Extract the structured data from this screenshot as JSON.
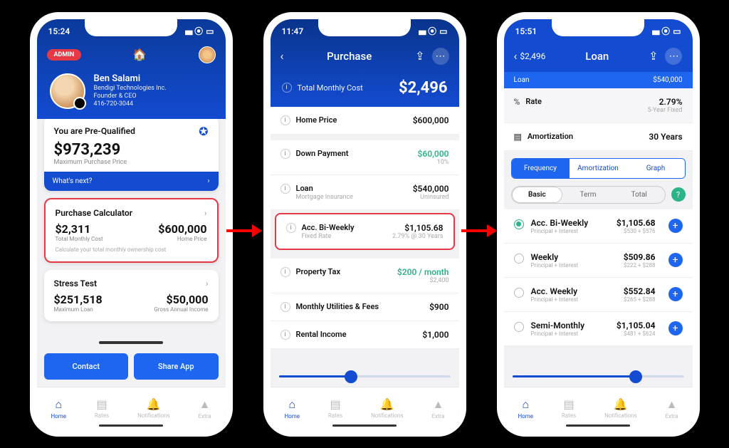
{
  "phone1": {
    "time": "15:24",
    "admin_badge": "ADMIN",
    "profile": {
      "name": "Ben Salami",
      "company": "Bendigi Technologies Inc.",
      "title": "Founder & CEO",
      "phone": "416-720-3044"
    },
    "prequalified": {
      "title": "You are Pre-Qualified",
      "amount": "$973,239",
      "sub": "Maximum Purchase Price",
      "next": "What's next?"
    },
    "calc": {
      "title": "Purchase Calculator",
      "left_val": "$2,311",
      "left_lab": "Total Monthly Cost",
      "right_val": "$600,000",
      "right_lab": "Home Price",
      "hint": "Calculate your total monthly ownership cost"
    },
    "stress": {
      "title": "Stress Test",
      "left_val": "$251,518",
      "left_lab": "Maximum Loan",
      "right_val": "$50,000",
      "right_lab": "Gross Annual Income"
    },
    "cta": {
      "contact": "Contact",
      "share": "Share App"
    }
  },
  "phone2": {
    "time": "11:47",
    "title": "Purchase",
    "total_label": "Total Monthly Cost",
    "total_value": "$2,496",
    "rows": {
      "home_price": {
        "label": "Home Price",
        "value": "$600,000"
      },
      "down": {
        "label": "Down Payment",
        "value": "$60,000",
        "sub": "10%"
      },
      "loan": {
        "label": "Loan",
        "sub_l": "Mortgage Insurance",
        "value": "$540,000",
        "sub": "Uninsured"
      },
      "biweekly": {
        "label": "Acc. Bi-Weekly",
        "sub_l": "Fixed Rate",
        "value": "$1,105.68",
        "sub": "2.79% @ 30 Years"
      },
      "tax": {
        "label": "Property Tax",
        "value": "$200 / month",
        "sub": "$2,400"
      },
      "util": {
        "label": "Monthly Utilities & Fees",
        "value": "$900"
      },
      "rent": {
        "label": "Rental Income",
        "value": "$1,000"
      }
    }
  },
  "phone3": {
    "time": "15:51",
    "back_crumb": "$2,496",
    "title": "Loan",
    "crumb_left": "Loan",
    "crumb_right": "$540,000",
    "rate": {
      "label": "Rate",
      "value": "2.79%",
      "sub": "5-Year Fixed"
    },
    "amort": {
      "label": "Amortization",
      "value": "30 Years"
    },
    "segs": {
      "a": "Frequency",
      "b": "Amortization",
      "c": "Graph"
    },
    "subsegs": {
      "a": "Basic",
      "b": "Term",
      "c": "Total"
    },
    "opts": {
      "o1": {
        "title": "Acc. Bi-Weekly",
        "sub": "Principal + Interest",
        "val": "$1,105.68",
        "dets": "$530 + $576"
      },
      "o2": {
        "title": "Weekly",
        "sub": "Principal + Interest",
        "val": "$509.86",
        "dets": "$222 + $288"
      },
      "o3": {
        "title": "Acc. Weekly",
        "sub": "Principal + Interest",
        "val": "$552.84",
        "dets": "$265 + $288"
      },
      "o4": {
        "title": "Semi-Monthly",
        "sub": "Principal + Interest",
        "val": "$1,105.04",
        "dets": "$481 + $624"
      }
    }
  },
  "tabs": {
    "home": "Home",
    "rates": "Rates",
    "notif": "Notifications",
    "extra": "Extra"
  }
}
